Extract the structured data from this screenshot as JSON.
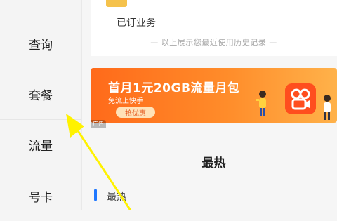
{
  "sidebar": {
    "items": [
      {
        "label": "查询"
      },
      {
        "label": "套餐"
      },
      {
        "label": "流量"
      },
      {
        "label": "号卡"
      }
    ]
  },
  "main": {
    "subscribed_label": "已订业务",
    "history_note": "— 以上展示您最近使用历史记录 —",
    "banner": {
      "title": "首月1元20GB流量月包",
      "subtitle": "免流上快手",
      "cta": "抢优惠",
      "ad_tag": "广告"
    },
    "section_title": "最热",
    "hot_label": "最热"
  },
  "colors": {
    "accent_blue": "#1f78ff",
    "banner_orange": "#ff6a1a",
    "pointer_yellow": "#fff200"
  }
}
